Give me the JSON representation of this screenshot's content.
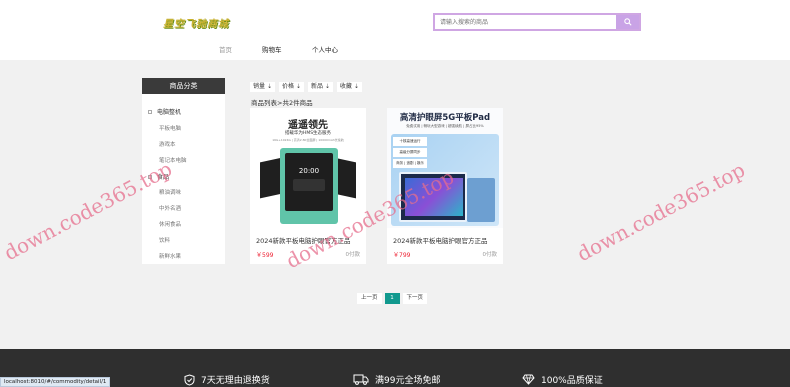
{
  "header": {
    "logo_text": "星空飞驰商城",
    "search": {
      "placeholder": "请输入搜索的商品",
      "icon": "search-icon"
    },
    "nav": [
      {
        "label": "首页"
      },
      {
        "label": "购物车"
      },
      {
        "label": "个人中心"
      }
    ]
  },
  "sidebar": {
    "title": "商品分类",
    "categories": [
      {
        "label": "电脑整机",
        "children": [
          "平板电脑",
          "游戏本",
          "笔记本电脑"
        ]
      },
      {
        "label": "食品",
        "children": [
          "粮油调味",
          "中外名酒",
          "休闲食品",
          "饮料",
          "新鲜水果"
        ]
      }
    ]
  },
  "toolbar": {
    "sorts": [
      {
        "label": "销量"
      },
      {
        "label": "价格"
      },
      {
        "label": "新品"
      },
      {
        "label": "收藏"
      }
    ],
    "count_text": "商品列表>共2件商品"
  },
  "products": [
    {
      "name": "2024新款平板电脑护眼官方正品",
      "price": "￥599",
      "paid": "0付款",
      "banner_title": "遥遥领先",
      "banner_sub": "搭载华为HMS生态服务",
      "banner_spec": "16G+1024G | 高清2.8K全面屏 | 10000mAh长续航",
      "screen_time": "20:00"
    },
    {
      "name": "2024新款平板电脑护眼官方正品",
      "price": "￥799",
      "paid": "0付款",
      "banner_title": "高清护眼屏5G平板Pad",
      "banner_sub": "免费试用 | 畅玩大型游戏 | 超强续航 | 屏占比95%",
      "tags": [
        "十核高速运行",
        "高级分屏同步",
        "商务 | 追剧 | 娱乐"
      ]
    }
  ],
  "pagination": {
    "prev": "上一页",
    "current": "1",
    "next": "下一页"
  },
  "footer": {
    "features": [
      {
        "icon": "shield-check-icon",
        "label": "7天无理由退换货"
      },
      {
        "icon": "truck-icon",
        "label": "满99元全场免邮"
      },
      {
        "icon": "diamond-icon",
        "label": "100%品质保证"
      }
    ]
  },
  "status_bar": {
    "url": "localhost:8010/#/commodity/detail/1"
  },
  "watermark": "down.code365.top",
  "colors": {
    "accent": "#11998e",
    "search_border": "#cfa6e3",
    "price": "#e22233",
    "footer_bg": "#2f2f2f"
  }
}
